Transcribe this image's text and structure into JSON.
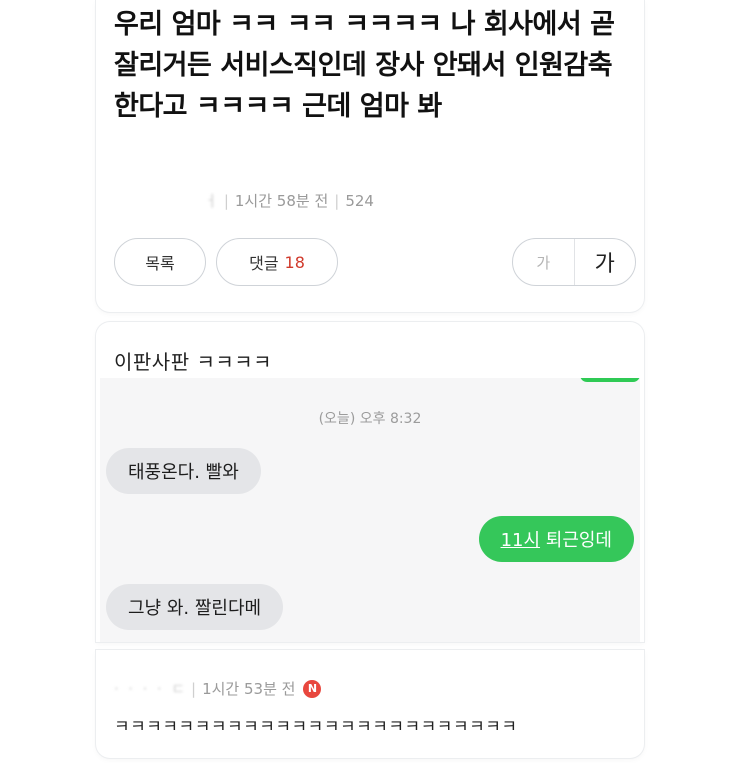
{
  "post": {
    "title": "우리 엄마 ㅋㅋ ㅋㅋ ㅋㅋㅋㅋ 나 회사에서 곧 잘리거든 서비스직인데 장사 안돼서 인원감축 한다고 ㅋㅋㅋㅋ 근데 엄마 봐",
    "author_masked": "ㅓ",
    "time": "1시간 58분 전",
    "views": "524",
    "list_button": "목록",
    "comments_label": "댓글",
    "comments_count": "18",
    "font_small": "가",
    "font_large": "가"
  },
  "comment": {
    "text": "이판사판 ㅋㅋㅋㅋ",
    "chat": {
      "date": "(오늘) 오후 8:32",
      "messages": [
        {
          "text": "태풍온다. 빨와",
          "direction": "incoming"
        },
        {
          "text_prefix": "11시",
          "text_rest": " 퇴근잉데",
          "direction": "outgoing"
        },
        {
          "text": "그냥 와. 짤린다메",
          "direction": "incoming"
        }
      ]
    }
  },
  "reply": {
    "author_masked": "·  ·  ·  ·  ㄷ",
    "time": "1시간 53분 전",
    "badge": "N",
    "text": "ㅋㅋㅋㅋㅋㅋㅋㅋㅋㅋㅋㅋㅋㅋㅋㅋㅋㅋㅋㅋㅋㅋㅋㅋㅋ"
  },
  "colors": {
    "accent_red": "#d0392b",
    "badge_red": "#e8473e",
    "bubble_green": "#35c75a",
    "bubble_gray": "#e4e5e8"
  }
}
